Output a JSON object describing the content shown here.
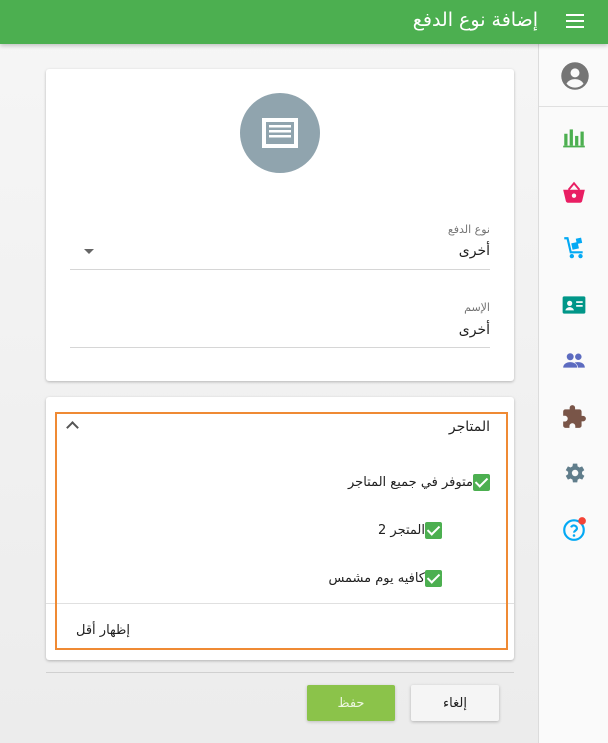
{
  "header": {
    "title": "إضافة نوع الدفع",
    "background_color": "#4caf50",
    "menu_icon": "menu-icon"
  },
  "sidebar": {
    "items": [
      {
        "name": "account",
        "icon": "account-circle-icon",
        "color": "#757575"
      },
      {
        "name": "reports",
        "icon": "bar-chart-icon",
        "color": "#4caf50"
      },
      {
        "name": "sales",
        "icon": "basket-icon",
        "color": "#e91e63"
      },
      {
        "name": "inventory",
        "icon": "hand-truck-icon",
        "color": "#03a9f4"
      },
      {
        "name": "customers",
        "icon": "contact-card-icon",
        "color": "#009688"
      },
      {
        "name": "employees",
        "icon": "people-icon",
        "color": "#5c6bc0"
      },
      {
        "name": "addons",
        "icon": "puzzle-icon",
        "color": "#795548"
      },
      {
        "name": "settings",
        "icon": "gear-icon",
        "color": "#607d8b"
      },
      {
        "name": "help",
        "icon": "help-icon",
        "color": "#03a9f4",
        "badge_color": "#f44336"
      }
    ]
  },
  "payment_form": {
    "avatar_icon": "receipt-icon",
    "avatar_color": "#90a4ae",
    "type_label": "نوع الدفع",
    "type_value": "أخرى",
    "name_label": "الإسم",
    "name_value": "أخرى"
  },
  "stores": {
    "title": "المتاجر",
    "all_stores_label": "متوفر في جميع المتاجر",
    "items": [
      {
        "label": "المتجر 2",
        "checked": true
      },
      {
        "label": "كافيه يوم مشمس",
        "checked": true
      }
    ],
    "show_less_label": "إظهار أقل",
    "highlight_color": "#ef8a34"
  },
  "actions": {
    "cancel_label": "إلغاء",
    "save_label": "حفظ",
    "save_color": "#8bc34a"
  }
}
